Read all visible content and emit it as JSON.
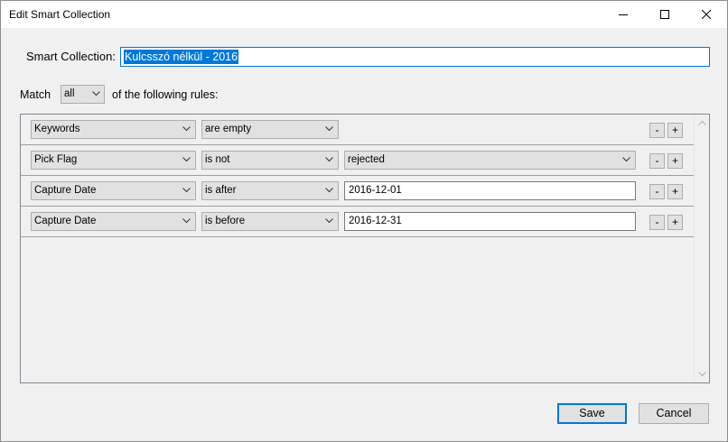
{
  "window": {
    "title": "Edit Smart Collection"
  },
  "smart_collection": {
    "label": "Smart Collection:",
    "value": "Kulcsszó nélkül - 2016"
  },
  "match": {
    "prefix": "Match",
    "selected": "all",
    "suffix": "of the following rules:"
  },
  "rules": [
    {
      "field": "Keywords",
      "operator": "are empty",
      "value": "",
      "value_kind": "none"
    },
    {
      "field": "Pick Flag",
      "operator": "is not",
      "value": "rejected",
      "value_kind": "dropdown"
    },
    {
      "field": "Capture Date",
      "operator": "is after",
      "value": "2016-12-01",
      "value_kind": "text"
    },
    {
      "field": "Capture Date",
      "operator": "is before",
      "value": "2016-12-31",
      "value_kind": "text"
    }
  ],
  "row_buttons": {
    "remove": "-",
    "add": "+"
  },
  "buttons": {
    "save": "Save",
    "cancel": "Cancel"
  },
  "colors": {
    "accent": "#0078d7",
    "dialog_bg": "#f0f0f0",
    "control_bg": "#e1e1e1"
  }
}
